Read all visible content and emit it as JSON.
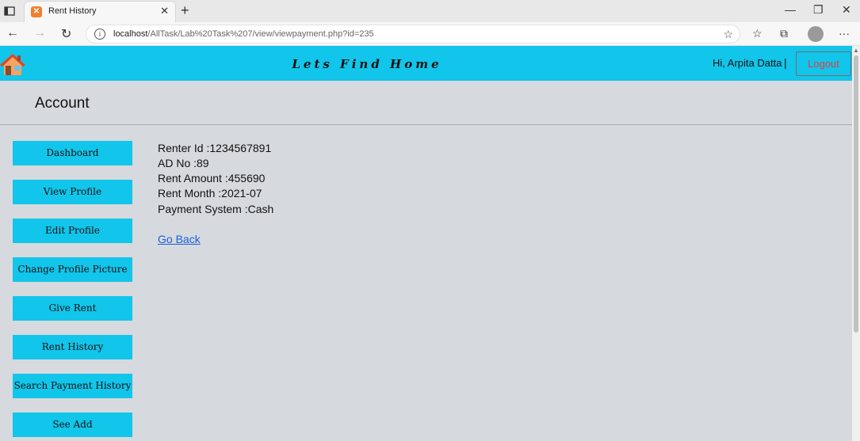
{
  "browser": {
    "tab_title": "Rent History",
    "url_host": "localhost",
    "url_path": "/AllTask/Lab%20Task%207/view/viewpayment.php?id=235"
  },
  "header": {
    "brand": "Lets Find Home",
    "greeting": "Hi, Arpita Datta",
    "separator": "|",
    "logout_label": "Logout"
  },
  "section_title": "Account",
  "sidebar": {
    "items": [
      {
        "label": "Dashboard"
      },
      {
        "label": "View Profile"
      },
      {
        "label": "Edit Profile"
      },
      {
        "label": "Change Profile Picture"
      },
      {
        "label": "Give Rent"
      },
      {
        "label": "Rent History"
      },
      {
        "label": "Search Payment History"
      },
      {
        "label": "See Add"
      }
    ]
  },
  "payment": {
    "renter_id": "Renter Id :1234567891",
    "ad_no": "AD No :89",
    "rent_amount": "Rent Amount :455690",
    "rent_month": "Rent Month :2021-07",
    "payment_system": "Payment System :Cash",
    "go_back": "Go Back"
  },
  "colors": {
    "accent": "#12c5ea",
    "page_bg": "#d6d9de",
    "link": "#1a5fd8",
    "logout_text": "#e04040"
  }
}
